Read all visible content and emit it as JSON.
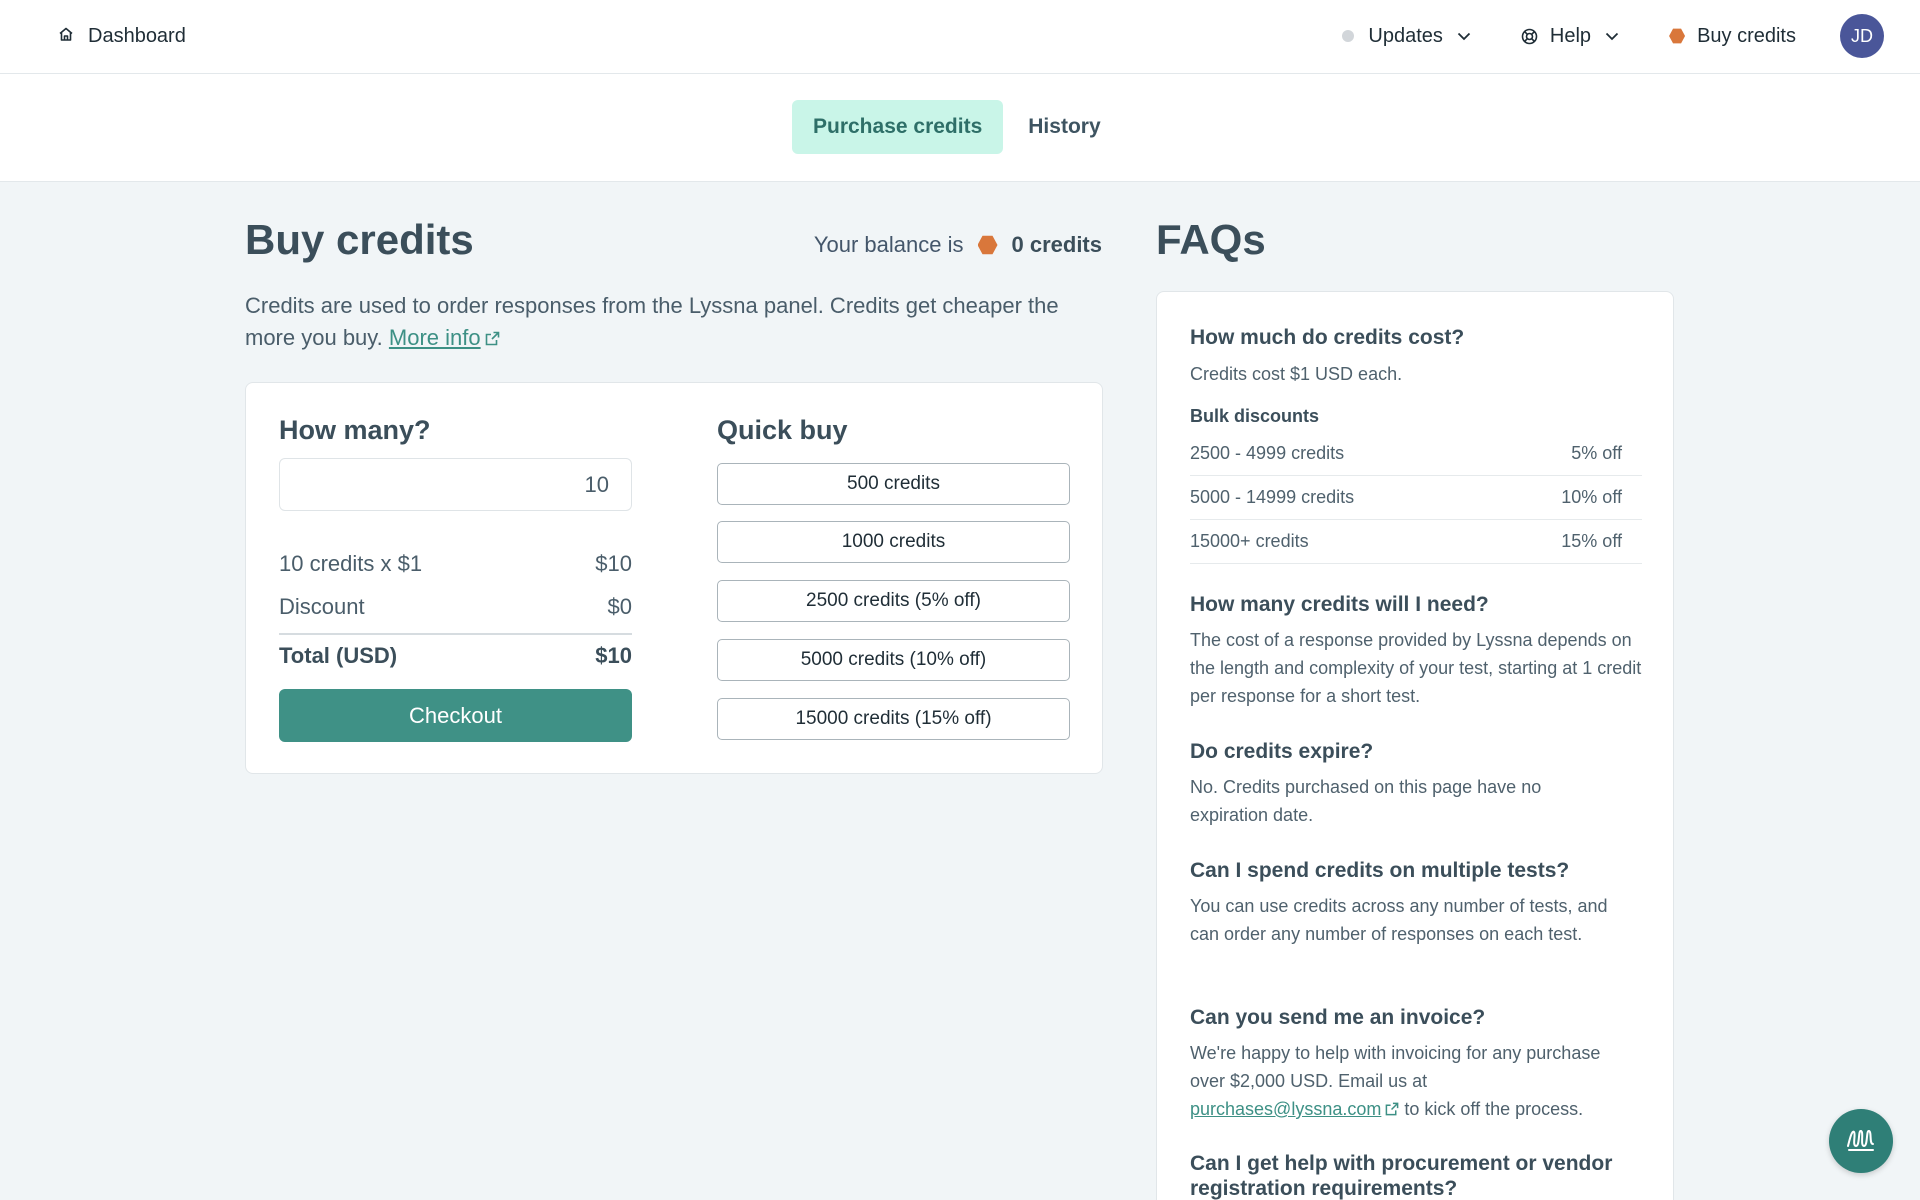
{
  "nav": {
    "dashboard_label": "Dashboard",
    "updates_label": "Updates",
    "help_label": "Help",
    "buy_credits_label": "Buy credits",
    "avatar_initials": "JD"
  },
  "tabs": [
    {
      "label": "Purchase credits",
      "active": true
    },
    {
      "label": "History",
      "active": false
    }
  ],
  "main": {
    "title": "Buy credits",
    "balance_prefix": "Your balance is",
    "balance_value": "0 credits",
    "intro_text": "Credits are used to order responses from the Lyssna panel. Credits get cheaper the more you buy.",
    "more_info_link": "More info"
  },
  "calculator": {
    "title": "How many?",
    "quantity_value": "10",
    "line_label": "10 credits x $1",
    "line_value": "$10",
    "discount_label": "Discount",
    "discount_value": "$0",
    "total_label": "Total (USD)",
    "total_value": "$10",
    "checkout_label": "Checkout"
  },
  "quick_buy": {
    "title": "Quick buy",
    "options": [
      "500 credits",
      "1000 credits",
      "2500 credits (5% off)",
      "5000 credits (10% off)",
      "15000 credits (15% off)"
    ]
  },
  "faq": {
    "title": "FAQs",
    "q1": "How much do credits cost?",
    "a1": "Credits cost $1 USD each.",
    "bulk_title": "Bulk discounts",
    "bulk": [
      {
        "range": "2500 - 4999 credits",
        "discount": "5% off"
      },
      {
        "range": "5000 - 14999 credits",
        "discount": "10% off"
      },
      {
        "range": "15000+ credits",
        "discount": "15% off"
      }
    ],
    "q2": "How many credits will I need?",
    "a2": "The cost of a response provided by Lyssna depends on the length and complexity of your test, starting at 1 credit per response for a short test.",
    "q3": "Do credits expire?",
    "a3": "No. Credits purchased on this page have no expiration date.",
    "q4": "Can I spend credits on multiple tests?",
    "a4": "You can use credits across any number of tests, and can order any number of responses on each test.",
    "q5": "Can you send me an invoice?",
    "a5_pre": "We're happy to help with invoicing for any purchase over $2,000 USD. Email us at",
    "a5_email": "purchases@lyssna.com",
    "a5_post": "to kick off the process.",
    "q6": "Can I get help with procurement or vendor registration requirements?"
  },
  "colors": {
    "accent": "#3f9186",
    "tab_active_bg": "#c9f5e8",
    "coin": "#d9773b",
    "avatar": "#4a5699"
  }
}
